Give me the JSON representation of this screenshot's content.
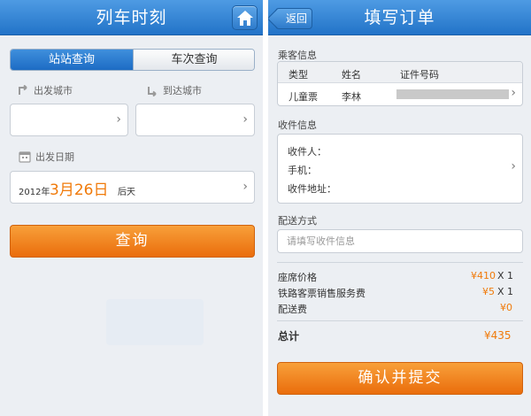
{
  "left": {
    "title": "列车时刻",
    "tabs": [
      {
        "label": "站站查询",
        "active": true
      },
      {
        "label": "车次查询",
        "active": false
      }
    ],
    "from_label": "出发城市",
    "to_label": "到达城市",
    "from_value": "",
    "to_value": "",
    "date_label": "出发日期",
    "date": {
      "year": "2012年",
      "month_day": "3月26日",
      "relative": "后天"
    },
    "query_button": "查询"
  },
  "right": {
    "back_label": "返回",
    "title": "填写订单",
    "passenger_section": "乘客信息",
    "passenger_headers": [
      "类型",
      "姓名",
      "证件号码"
    ],
    "passenger_row": {
      "type": "儿童票",
      "name": "李林"
    },
    "receiver_section": "收件信息",
    "receiver_fields": [
      "收件人：",
      "手机：",
      "收件地址："
    ],
    "delivery_section": "配送方式",
    "delivery_placeholder": "请填写收件信息",
    "fees": [
      {
        "label": "座席价格",
        "price": "¥410",
        "qty": "X 1"
      },
      {
        "label": "铁路客票销售服务费",
        "price": "¥5",
        "qty": "X 1"
      },
      {
        "label": "配送费",
        "price": "¥0",
        "qty": ""
      }
    ],
    "total_label": "总计",
    "total_value": "¥435",
    "submit_button": "确认并提交"
  },
  "colors": {
    "nav_blue": "#2273c8",
    "accent_orange": "#f07a0a",
    "button_orange": "#ea6d0c"
  }
}
